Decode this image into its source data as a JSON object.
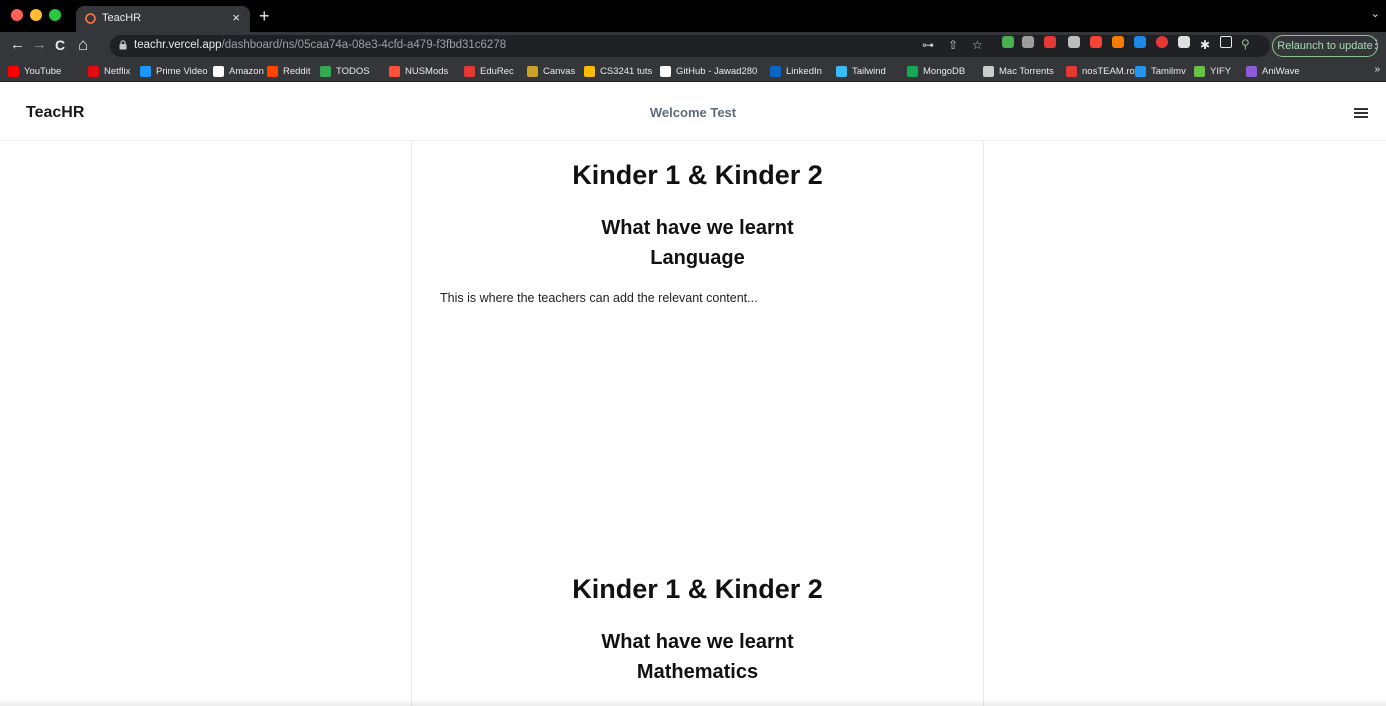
{
  "browser": {
    "tab": {
      "title": "TeacHR",
      "close": "×"
    },
    "new_tab": "+",
    "tab_dropdown": "⌄",
    "nav": {
      "back": "←",
      "forward": "→",
      "reload": "C",
      "home": "⌂"
    },
    "url_host": "teachr.vercel.app",
    "url_path": "/dashboard/ns/05caa74a-08e3-4cfd-a479-f3fbd31c6278",
    "relaunch": "Relaunch to update",
    "menu": "⋮",
    "bookmarks": [
      {
        "label": "YouTube",
        "color": "#ff0000"
      },
      {
        "label": "Netflix",
        "color": "#e50914"
      },
      {
        "label": "Prime Video",
        "color": "#1a98ff"
      },
      {
        "label": "Amazon",
        "color": "#ffffff"
      },
      {
        "label": "Reddit",
        "color": "#ff4500"
      },
      {
        "label": "TODOS",
        "color": "#34a853"
      },
      {
        "label": "NUSMods",
        "color": "#ff5138"
      },
      {
        "label": "EduRec",
        "color": "#e53935"
      },
      {
        "label": "Canvas",
        "color": "#c9a227"
      },
      {
        "label": "CS3241 tuts",
        "color": "#fbbc04"
      },
      {
        "label": "GitHub - Jawad280",
        "color": "#ffffff"
      },
      {
        "label": "LinkedIn",
        "color": "#0a66c2"
      },
      {
        "label": "Tailwind",
        "color": "#38bdf8"
      },
      {
        "label": "MongoDB",
        "color": "#13aa52"
      },
      {
        "label": "Mac Torrents",
        "color": "#cccccc"
      },
      {
        "label": "nosTEAM.ro",
        "color": "#e53935"
      },
      {
        "label": "Tamilmv",
        "color": "#2196f3"
      },
      {
        "label": "YIFY",
        "color": "#6ac045"
      },
      {
        "label": "AniWave",
        "color": "#8e5cd9"
      }
    ],
    "bookmarks_more": "»"
  },
  "page": {
    "brand": "TeacHR",
    "welcome": "Welcome Test",
    "sections": [
      {
        "title": "Kinder 1 & Kinder 2",
        "subtitle": "What have we learnt",
        "subject": "Language",
        "body": "This is where the teachers can add the relevant content..."
      },
      {
        "title": "Kinder 1 & Kinder 2",
        "subtitle": "What have we learnt",
        "subject": "Mathematics"
      }
    ]
  }
}
